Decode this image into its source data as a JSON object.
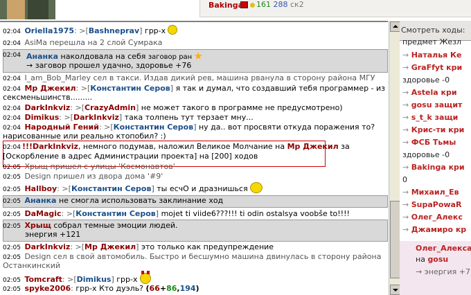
{
  "top": {
    "user": "Bakinga",
    "hp": "161",
    "mp": "288",
    "rest": "ск2"
  },
  "chat": {
    "r1": {
      "time": "02:04",
      "nick": "Oriella1975",
      "to": "Bashneprav",
      "text": "грр-х"
    },
    "r2": {
      "time": "02:04",
      "text": "AsiMa перешла на 2 слой Сумрака"
    },
    "r3": {
      "time": "02:04",
      "nick": "Ананка",
      "text": "наколдовала на себя",
      "spell": "заговор ран",
      "line2": "→ заговор прошел удачно, здоровье +76"
    },
    "r4": {
      "time": "02:04",
      "text": "I_am_Bob_Marley сел в такси. Издав дикий рев, машина рванула в сторону района МГУ"
    },
    "r5": {
      "time": "02:04",
      "nick": "Мр Джекил",
      "to": "Константин Серов",
      "text": "я так и думал, что создавший тебя программер - из",
      "line2": "сексменьшинств........."
    },
    "r6": {
      "time": "02:04",
      "nick": "DarkInkviz",
      "to": "CrazyAdmin",
      "text": "не может такого в программе не предусмотрено)"
    },
    "r7": {
      "time": "02:04",
      "nick": "Dimikus",
      "to": "DarkInkviz",
      "text": "така толпень тут терзает мну..."
    },
    "r8": {
      "time": "02:04",
      "nick": "Народный Гений",
      "to": "Константин Серов",
      "text": "ну да.. вот просвяти откуда поражения то?",
      "line2": "нарисованные или реально ктопобил? :)"
    },
    "r9": {
      "time": "02:04",
      "prefix": "!!!",
      "nick": "DarkInkviz",
      "text": ", немного подумав, наложил Великое Молчание на",
      "target": "Мр Джекил",
      "tail": "за",
      "line2": "[Оскорбление в адрес Администрации проекта] на [200] ходов"
    },
    "r10": {
      "time": "02:05",
      "text": "Хрыщ пришел с улицы 'Космонавтов'"
    },
    "r11": {
      "time": "02:05",
      "text": "Design пришел из двора дома '#9'"
    },
    "r12": {
      "time": "02:05",
      "nick": "Hallboy",
      "to": "Константин Серов",
      "text": "ты есчО и дразнишься"
    },
    "r13": {
      "time": "02:05",
      "nick": "Ананка",
      "text": "не смогла использовать заклинание ход"
    },
    "r14": {
      "time": "02:05",
      "nick": "DaMagic",
      "to": "Константин Серов",
      "text": "mojet ti viide6???!!! ti odin ostalsya voobše to!!!!"
    },
    "r15": {
      "time": "02:05",
      "nick": "Хрыщ",
      "text": "собрал темные эмоции людей.",
      "line2": "энергия +121"
    },
    "r16": {
      "time": "02:05",
      "nick": "DarkInkviz",
      "to": "Мр Джекил",
      "text": "это только как предупреждение"
    },
    "r17": {
      "time": "02:05",
      "text": "Design сел в свой автомобиль. Быстро и бесшумно машина двинулась в сторону района",
      "line2": "Останкинский"
    },
    "r18": {
      "time": "02:05",
      "nick": "Tomcraft",
      "to": "Dimikus",
      "text": "грр-х"
    },
    "r19": {
      "time": "02:05",
      "nick": "spyke2006",
      "text": "грр-х Кто дуэль?",
      "n1": "66",
      "n2": "86",
      "n3": "194"
    }
  },
  "side": {
    "header": "Смотреть ходы:",
    "lines": [
      "предмет Жезл",
      "Наталья Ке",
      "GraFfyt кри",
      "здоровье -0",
      "Astela кри",
      "gosu защит",
      "s_t_k защи",
      "Крис-ти кри",
      "ФСБ Тьмы",
      "здоровье -0",
      "Bakinga кри",
      "0",
      "Михаил_Ев",
      "SupaPowaR",
      "Олег_Алекс",
      "Джамиро кр"
    ],
    "pink1": "Олег_Алекса",
    "pink2": "на",
    "pink3": "gosu",
    "pink4": "→ энергия +7"
  }
}
